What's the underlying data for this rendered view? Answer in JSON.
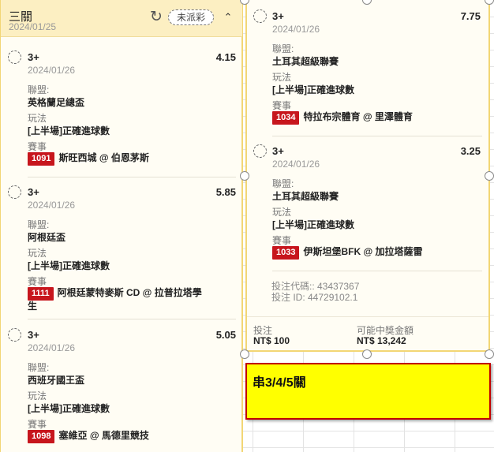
{
  "left_ticket": {
    "title": "三關",
    "date": "2024/01/25",
    "status": "未派彩",
    "bets": [
      {
        "selection": "3+",
        "odds": "4.15",
        "date": "2024/01/26",
        "league_label": "聯盟:",
        "league": "英格蘭足總盃",
        "market_label": "玩法",
        "market": "[上半場]正確進球數",
        "event_label": "賽事",
        "code": "1091",
        "match": "斯旺西城 @ 伯恩茅斯"
      },
      {
        "selection": "3+",
        "odds": "5.85",
        "date": "2024/01/26",
        "league_label": "聯盟:",
        "league": "阿根廷盃",
        "market_label": "玩法",
        "market": "[上半場]正確進球數",
        "event_label": "賽事",
        "code": "1111",
        "match": "阿根廷蒙特麥斯 CD @ 拉普拉塔學生"
      },
      {
        "selection": "3+",
        "odds": "5.05",
        "date": "2024/01/26",
        "league_label": "聯盟:",
        "league": "西班牙國王盃",
        "market_label": "玩法",
        "market": "[上半場]正確進球數",
        "event_label": "賽事",
        "code": "1098",
        "match": "塞維亞 @ 馬德里競技"
      }
    ]
  },
  "right_ticket": {
    "bets": [
      {
        "selection": "3+",
        "odds": "7.75",
        "date": "2024/01/26",
        "league_label": "聯盟:",
        "league": "土耳其超級聯賽",
        "market_label": "玩法",
        "market": "[上半場]正確進球數",
        "event_label": "賽事",
        "code": "1034",
        "match": "特拉布宗體育 @ 里澤體育"
      },
      {
        "selection": "3+",
        "odds": "3.25",
        "date": "2024/01/26",
        "league_label": "聯盟:",
        "league": "土耳其超級聯賽",
        "market_label": "玩法",
        "market": "[上半場]正確進球數",
        "event_label": "賽事",
        "code": "1033",
        "match": "伊斯坦堡BFK @ 加拉塔薩雷"
      }
    ],
    "bet_code": "投注代碼:: 43437367",
    "bet_id": "投注 ID: 44729102.1",
    "stake_label": "投注",
    "stake": "NT$ 100",
    "payout_label": "可能中獎金額",
    "payout": "NT$ 13,242"
  },
  "note": {
    "text": "串3/4/5關"
  },
  "icons": {
    "refresh": "refresh-icon",
    "collapse": "chevron-up-icon"
  },
  "colors": {
    "header_bg": "#fcefc2",
    "code_badge": "#c7161d",
    "note_bg": "#ffff00",
    "note_border": "#c00000"
  }
}
